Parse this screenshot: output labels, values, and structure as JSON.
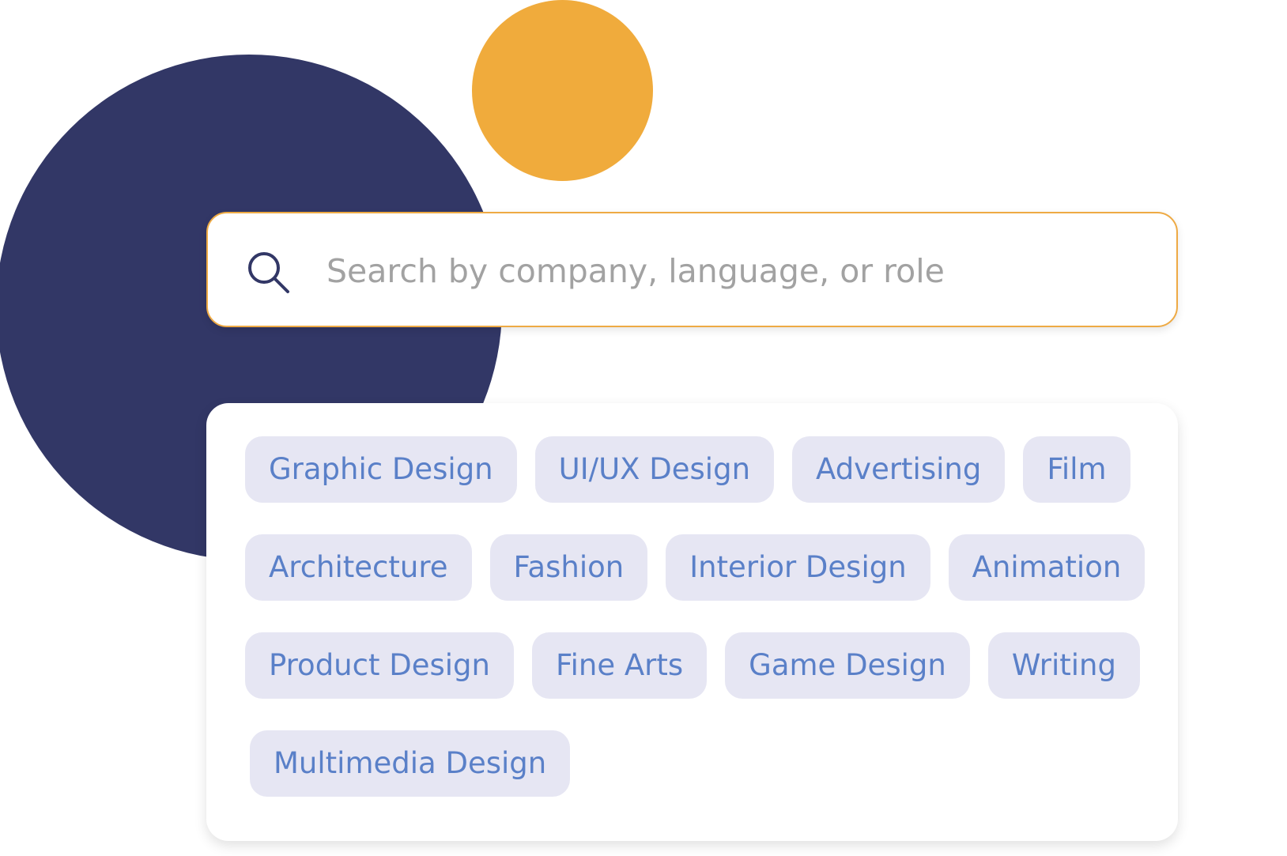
{
  "colors": {
    "navy_circle": "#323766",
    "orange_circle": "#f0ab3c",
    "search_border": "#eeaa44",
    "tag_background": "#e6e6f3",
    "tag_text": "#5a80c8",
    "placeholder_text": "#a2a2a2",
    "icon_color": "#323766"
  },
  "search": {
    "icon": "search-icon",
    "placeholder": "Search by company, language, or role",
    "value": ""
  },
  "tags": {
    "row1": [
      "Graphic Design",
      "UI/UX Design",
      "Advertising",
      "Film"
    ],
    "row2": [
      "Architecture",
      "Fashion",
      "Interior Design",
      "Animation"
    ],
    "row3": [
      "Product Design",
      "Fine Arts",
      "Game Design",
      "Writing"
    ],
    "row4": [
      "Multimedia Design"
    ]
  }
}
